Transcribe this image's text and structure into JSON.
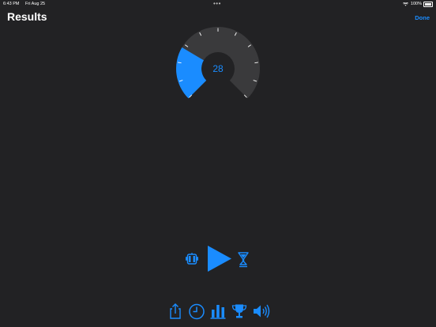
{
  "status": {
    "time": "6:43 PM",
    "date": "Fri Aug 25",
    "dots": "•••",
    "battery": "100%"
  },
  "header": {
    "title": "Results",
    "done_label": "Done"
  },
  "gauge": {
    "value": "28",
    "level": 0.28,
    "accent": "#1a8cff",
    "track": "#3a3a3c"
  },
  "controls": {
    "left_icon": "robot-icon",
    "center_icon": "play-icon",
    "right_icon": "timer-glass-icon"
  },
  "toolbar": {
    "items": [
      "share-icon",
      "clock-icon",
      "bar-chart-icon",
      "trophy-icon",
      "speaker-icon"
    ]
  },
  "colors": {
    "background": "#222224",
    "accent": "#1a8cff",
    "text": "#ffffff"
  }
}
